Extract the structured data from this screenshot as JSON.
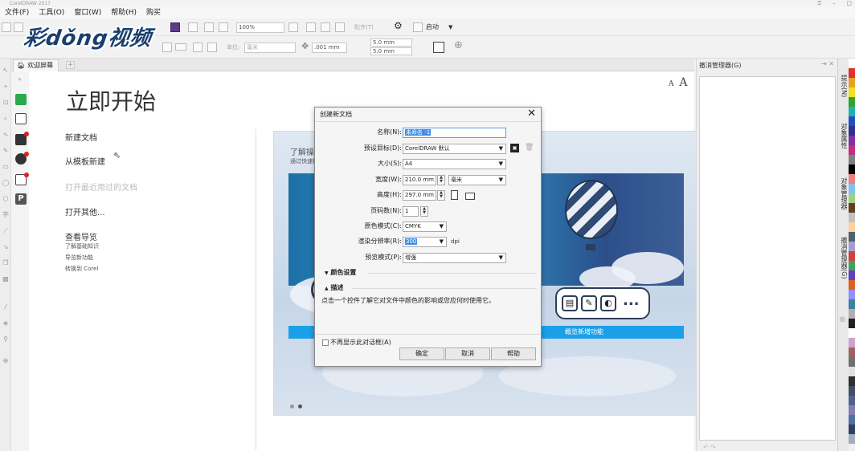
{
  "app": {
    "title": "CorelDRAW 2017",
    "window_buttons": [
      "⍰",
      "–",
      "▢"
    ]
  },
  "menu": [
    "文件(F)",
    "工具(O)",
    "窗口(W)",
    "帮助(H)",
    "购买"
  ],
  "toolbar": {
    "zoom": "100%",
    "snap_label": "贴齐(T)",
    "launch_label": "启动",
    "unit_label": "单位:",
    "unit_value": "毫米",
    "nudge": ".001 mm",
    "dup_x": "5.0 mm",
    "dup_y": "5.0 mm"
  },
  "watermark": "彩dǒng视频",
  "welcome": {
    "tab_label": "欢迎屏幕",
    "tab_add": "+",
    "title": "立即开始",
    "font_small": "A",
    "font_large": "A",
    "links": {
      "new_doc": "新建文档",
      "from_template": "从模板新建",
      "open_recent": "打开最近用过的文档",
      "open_other": "打开其他...",
      "guide": "查看导览"
    },
    "guide_sub": [
      "了解基础知识",
      "导览新功能",
      "转换到 Corel"
    ],
    "hero_intro": "了解操作中",
    "hero_intro2": "通过快速概览",
    "hero_bar_text": "概览新增功能",
    "pill_dots": "..."
  },
  "docker": {
    "title": "撤消管理器(G)",
    "buttons": "⇥ ✕",
    "footer": "↶ ↷"
  },
  "vtabs": [
    "提示(N)",
    "对象属性",
    "对象管理器",
    "撤消管理器(G)"
  ],
  "palette": [
    "#ffffff",
    "#e03030",
    "#e8a020",
    "#f0e020",
    "#30a030",
    "#20b0b0",
    "#2050c0",
    "#303090",
    "#8030a0",
    "#c03080",
    "#808080",
    "#000000",
    "#f08080",
    "#80c0f0",
    "#a0d080",
    "#604020",
    "#c0c0c0",
    "#ffd0a0",
    "#506070",
    "#a0a0d0",
    "#d04040",
    "#40a060",
    "#6040c0",
    "#e06020",
    "#9090ff",
    "#4080a0",
    "#b0b0b0",
    "#202020",
    "#ffffff",
    "#d0a0d0",
    "#a06060",
    "#707070",
    "#e0e0e0",
    "#303030",
    "#405060",
    "#506090",
    "#8080b0",
    "#5070a0",
    "#304060",
    "#a0b0c0"
  ],
  "dialog": {
    "title": "创建新文档",
    "close": "✕",
    "name_label": "名称(N):",
    "name_value": "未命名 -1",
    "preset_label": "预设目标(D):",
    "preset_value": "CorelDRAW 默认",
    "size_label": "大小(S):",
    "size_value": "A4",
    "width_label": "宽度(W):",
    "width_value": "210.0 mm",
    "unit_value": "毫米",
    "height_label": "高度(H):",
    "height_value": "297.0 mm",
    "pages_label": "页码数(N):",
    "pages_value": "1",
    "color_mode_label": "原色模式(C):",
    "color_mode_value": "CMYK",
    "dpi_label": "渲染分辨率(R):",
    "dpi_value": "300",
    "dpi_unit": "dpi",
    "preview_label": "预览模式(P):",
    "preview_value": "增强",
    "color_settings": "颜色设置",
    "description": "描述",
    "desc_text": "点击一个控件了解它对文件中颜色的影响或您应何时使用它。",
    "dont_show": "不再显示此对话框(A)",
    "ok": "确定",
    "cancel": "取消",
    "help": "帮助"
  }
}
